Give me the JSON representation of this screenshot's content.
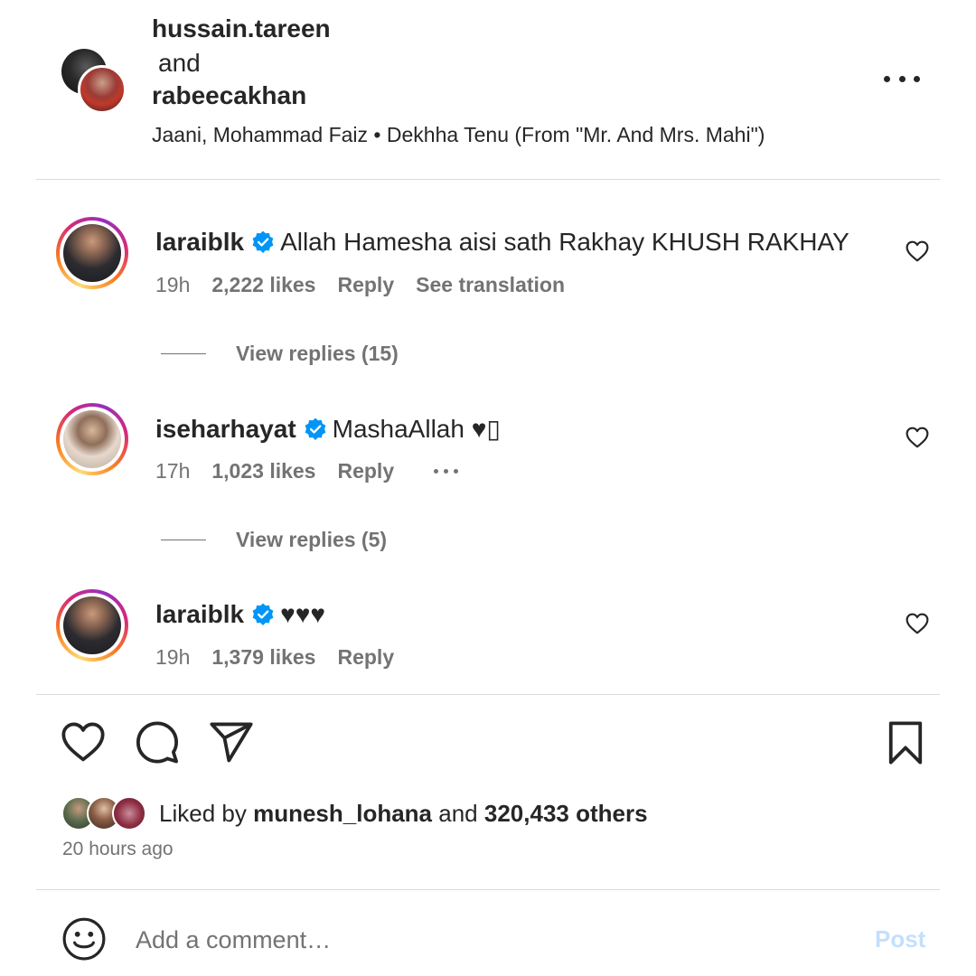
{
  "header": {
    "user1": "hussain.tareen",
    "conjunction": "and",
    "user2": "rabeecakhan",
    "audio": "Jaani, Mohammad Faiz • Dekhha Tenu (From \"Mr. And Mrs. Mahi\")",
    "more_icon": "more-horizontal-icon"
  },
  "comments": [
    {
      "username": "laraiblk",
      "verified": true,
      "text": "Allah Hamesha aisi sath Rakhay KHUSH RAKHAY",
      "time": "19h",
      "likes": "2,222 likes",
      "reply": "Reply",
      "translation": "See translation",
      "view_replies": "View replies (15)"
    },
    {
      "username": "iseharhayat",
      "verified": true,
      "text": "MashaAllah ♥▯",
      "time": "17h",
      "likes": "1,023 likes",
      "reply": "Reply",
      "view_replies": "View replies (5)"
    },
    {
      "username": "laraiblk",
      "verified": true,
      "text": "♥♥♥",
      "time": "19h",
      "likes": "1,379 likes",
      "reply": "Reply"
    }
  ],
  "actions": {
    "like_icon": "heart-icon",
    "comment_icon": "comment-icon",
    "share_icon": "send-icon",
    "save_icon": "bookmark-icon"
  },
  "liked_by": {
    "prefix": "Liked by",
    "user": "munesh_lohana",
    "middle": "and",
    "others": "320,433 others"
  },
  "time_ago": "20 hours ago",
  "add_comment": {
    "placeholder": "Add a comment…",
    "post_label": "Post",
    "emoji_icon": "emoji-icon"
  },
  "colors": {
    "text_primary": "#262626",
    "text_secondary": "#737373",
    "verified_blue": "#0095f6",
    "post_disabled": "#c3dffd",
    "divider": "#dbdbdb"
  }
}
